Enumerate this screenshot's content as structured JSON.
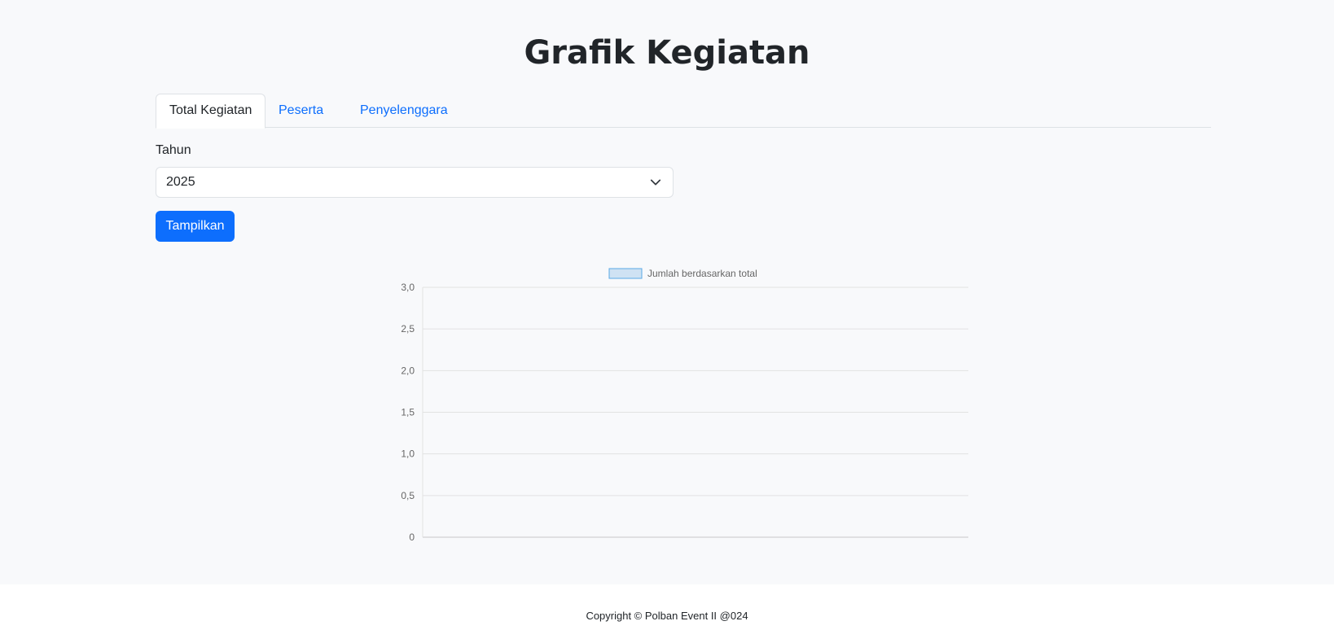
{
  "page": {
    "title": "Grafik Kegiatan"
  },
  "tabs": [
    {
      "label": "Total Kegiatan",
      "active": true
    },
    {
      "label": "Peserta",
      "active": false
    },
    {
      "label": "Penyelenggara",
      "active": false
    }
  ],
  "filter": {
    "year_label": "Tahun",
    "year_value": "2025",
    "submit_label": "Tampilkan"
  },
  "colors": {
    "accent": "#0d6efd",
    "legend_fill": "#cfe2f3",
    "legend_stroke": "#5aa9e6"
  },
  "chart_data": {
    "type": "bar",
    "categories": [],
    "series": [
      {
        "name": "Jumlah berdasarkan total",
        "values": []
      }
    ],
    "ylim": [
      0,
      3
    ],
    "yticks": [
      "0",
      "0,5",
      "1,0",
      "1,5",
      "2,0",
      "2,5",
      "3,0"
    ],
    "legend": "top",
    "grid": true
  },
  "footer": {
    "text": "Copyright © Polban Event II @024"
  }
}
